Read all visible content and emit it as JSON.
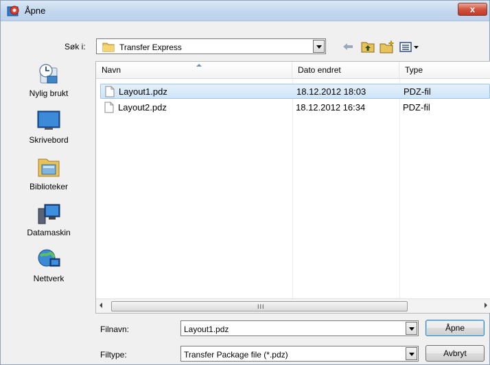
{
  "window": {
    "title": "Åpne",
    "close_symbol": "x",
    "app_icon": "app-logo-icon"
  },
  "lookin": {
    "label": "Søk i:",
    "value": "Transfer Express",
    "icon": "folder-icon"
  },
  "toolbar": {
    "back_icon": "back-arrow-icon",
    "up_icon": "up-folder-icon",
    "new_folder_icon": "new-folder-icon",
    "views_icon": "views-menu-icon"
  },
  "places": [
    {
      "label": "Nylig brukt",
      "icon": "recent-places-icon"
    },
    {
      "label": "Skrivebord",
      "icon": "desktop-icon"
    },
    {
      "label": "Biblioteker",
      "icon": "libraries-icon"
    },
    {
      "label": "Datamaskin",
      "icon": "computer-icon"
    },
    {
      "label": "Nettverk",
      "icon": "network-icon"
    }
  ],
  "filelist": {
    "columns": {
      "name": "Navn",
      "date": "Dato endret",
      "type": "Type"
    },
    "rows": [
      {
        "name": "Layout1.pdz",
        "date": "18.12.2012 18:03",
        "type": "PDZ-fil",
        "selected": true
      },
      {
        "name": "Layout2.pdz",
        "date": "18.12.2012 16:34",
        "type": "PDZ-fil",
        "selected": false
      }
    ],
    "scroll_grip": "III"
  },
  "filename": {
    "label": "Filnavn:",
    "value": "Layout1.pdz"
  },
  "filetype": {
    "label": "Filtype:",
    "value": "Transfer Package file (*.pdz)"
  },
  "buttons": {
    "open": "Åpne",
    "cancel": "Avbryt"
  },
  "colors": {
    "selection": "#cce4f7",
    "title_bar": "#c3d7ee",
    "close_button": "#c74a33"
  }
}
